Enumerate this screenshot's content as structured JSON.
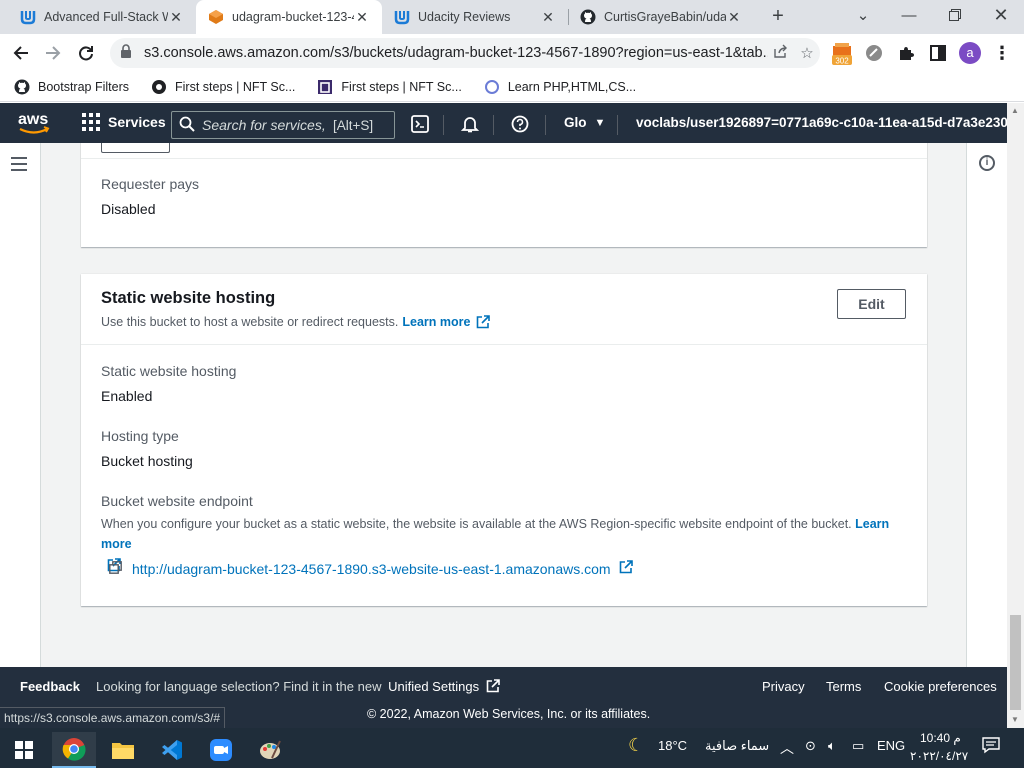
{
  "browser": {
    "tabs": [
      {
        "title": "Advanced Full-Stack W",
        "icon": "udacity-icon",
        "active": false
      },
      {
        "title": "udagram-bucket-123-4",
        "icon": "aws-s3-icon",
        "active": true
      },
      {
        "title": "Udacity Reviews",
        "icon": "udacity-icon",
        "active": false
      },
      {
        "title": "CurtisGrayeBabin/udag",
        "icon": "github-icon",
        "active": false
      }
    ],
    "url": "s3.console.aws.amazon.com/s3/buckets/udagram-bucket-123-4567-1890?region=us-east-1&tab...",
    "extension_badge": "302",
    "profile_initial": "a",
    "bookmarks": [
      {
        "label": "Bootstrap Filters",
        "icon": "github-icon"
      },
      {
        "label": "First steps | NFT Sc...",
        "icon": "nft-icon"
      },
      {
        "label": "First steps | NFT Sc...",
        "icon": "nft-square-icon"
      },
      {
        "label": "Learn PHP,HTML,CS...",
        "icon": "learn-icon"
      }
    ]
  },
  "aws_nav": {
    "services_label": "Services",
    "search_placeholder": "Search for services,",
    "search_hint": "[Alt+S]",
    "region": "Glo",
    "account": "voclabs/user1926897=0771a69c-c10a-11ea-a15d-d7a3e230"
  },
  "properties": {
    "requester_pays": {
      "label": "Requester pays",
      "value": "Disabled"
    },
    "static_hosting": {
      "title": "Static website hosting",
      "description": "Use this bucket to host a website or redirect requests.",
      "learn_more": "Learn more",
      "edit_label": "Edit",
      "fields": {
        "hosting_label": "Static website hosting",
        "hosting_value": "Enabled",
        "type_label": "Hosting type",
        "type_value": "Bucket hosting",
        "endpoint_label": "Bucket website endpoint",
        "endpoint_desc": "When you configure your bucket as a static website, the website is available at the AWS Region-specific website endpoint of the bucket.",
        "endpoint_learn_more": "Learn more",
        "endpoint_url": "http://udagram-bucket-123-4567-1890.s3-website-us-east-1.amazonaws.com"
      }
    }
  },
  "footer": {
    "feedback": "Feedback",
    "language_text": "Looking for language selection? Find it in the new",
    "unified_settings": "Unified Settings",
    "privacy": "Privacy",
    "terms": "Terms",
    "cookies": "Cookie preferences",
    "copyright": "© 2022, Amazon Web Services, Inc. or its affiliates.",
    "status_url": "https://s3.console.aws.amazon.com/s3/#"
  },
  "taskbar": {
    "weather_temp": "18°C",
    "weather_text": "سماء صافية",
    "language": "ENG",
    "time": "10:40 م",
    "date": "٢٠٢٢/٠٤/٢٧"
  },
  "colors": {
    "aws_nav": "#232f3e",
    "link": "#0073bb",
    "page_bg": "#f2f3f3"
  }
}
